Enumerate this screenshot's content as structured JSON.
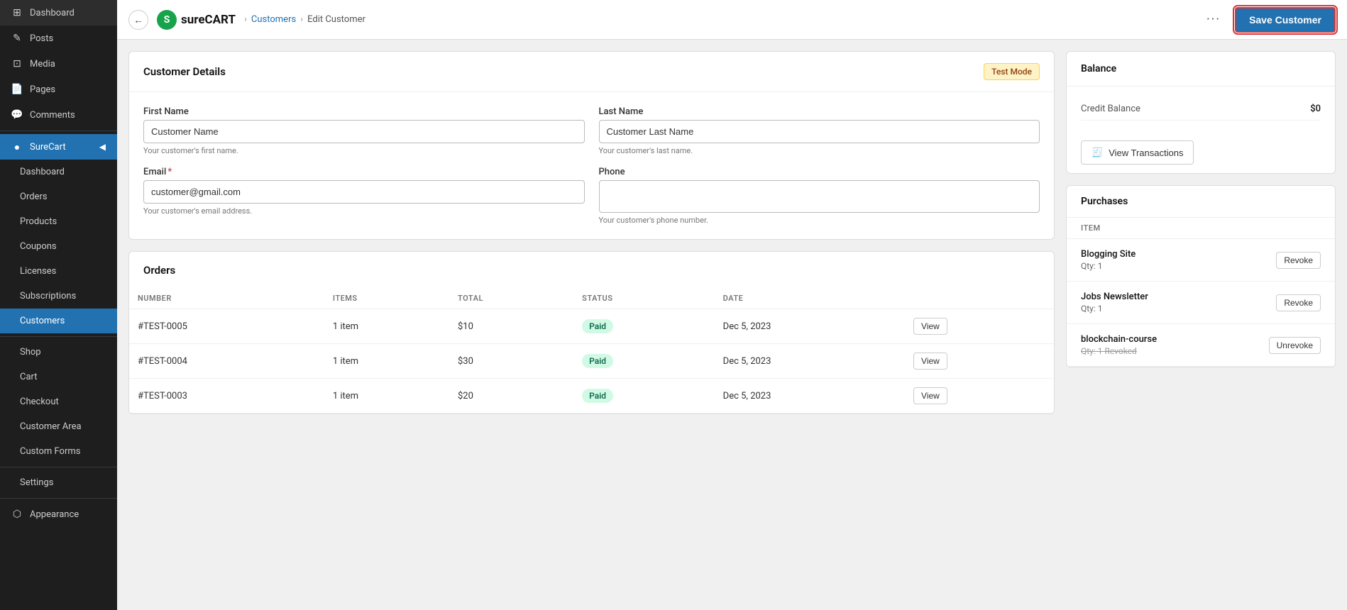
{
  "sidebar": {
    "items": [
      {
        "label": "Dashboard",
        "icon": "⊞",
        "active": false,
        "sub": false
      },
      {
        "label": "Posts",
        "icon": "✎",
        "active": false,
        "sub": false
      },
      {
        "label": "Media",
        "icon": "⊡",
        "active": false,
        "sub": false
      },
      {
        "label": "Pages",
        "icon": "📄",
        "active": false,
        "sub": false
      },
      {
        "label": "Comments",
        "icon": "💬",
        "active": false,
        "sub": false
      },
      {
        "label": "SureCart",
        "icon": "●",
        "active": true,
        "sub": false
      },
      {
        "label": "Dashboard",
        "icon": "",
        "active": false,
        "sub": true
      },
      {
        "label": "Orders",
        "icon": "",
        "active": false,
        "sub": true
      },
      {
        "label": "Products",
        "icon": "",
        "active": false,
        "sub": true
      },
      {
        "label": "Coupons",
        "icon": "",
        "active": false,
        "sub": true
      },
      {
        "label": "Licenses",
        "icon": "",
        "active": false,
        "sub": true
      },
      {
        "label": "Subscriptions",
        "icon": "",
        "active": false,
        "sub": true
      },
      {
        "label": "Customers",
        "icon": "",
        "active": false,
        "sub": true,
        "highlight": true
      },
      {
        "label": "Shop",
        "icon": "",
        "active": false,
        "sub": true
      },
      {
        "label": "Cart",
        "icon": "",
        "active": false,
        "sub": true
      },
      {
        "label": "Checkout",
        "icon": "",
        "active": false,
        "sub": true
      },
      {
        "label": "Customer Area",
        "icon": "",
        "active": false,
        "sub": true
      },
      {
        "label": "Custom Forms",
        "icon": "",
        "active": false,
        "sub": true
      },
      {
        "label": "Settings",
        "icon": "",
        "active": false,
        "sub": true
      },
      {
        "label": "Appearance",
        "icon": "⬡",
        "active": false,
        "sub": false
      }
    ]
  },
  "topbar": {
    "back_label": "←",
    "logo_initial": "S",
    "logo_text_bold": "sure",
    "logo_text_light": "CART",
    "breadcrumb": [
      "Customers",
      "Edit Customer"
    ],
    "dots_label": "···",
    "save_button_label": "Save Customer"
  },
  "customer_details": {
    "card_title": "Customer Details",
    "test_mode_badge": "Test Mode",
    "first_name_label": "First Name",
    "first_name_value": "Customer Name",
    "first_name_hint": "Your customer's first name.",
    "last_name_label": "Last Name",
    "last_name_value": "Customer Last Name",
    "last_name_hint": "Your customer's last name.",
    "email_label": "Email",
    "email_required": "*",
    "email_value": "customer@gmail.com",
    "email_hint": "Your customer's email address.",
    "phone_label": "Phone",
    "phone_value": "",
    "phone_hint": "Your customer's phone number."
  },
  "orders": {
    "card_title": "Orders",
    "columns": [
      "NUMBER",
      "ITEMS",
      "TOTAL",
      "STATUS",
      "DATE",
      ""
    ],
    "rows": [
      {
        "number": "#TEST-0005",
        "items": "1 item",
        "total": "$10",
        "status": "Paid",
        "date": "Dec 5, 2023",
        "action": "View"
      },
      {
        "number": "#TEST-0004",
        "items": "1 item",
        "total": "$30",
        "status": "Paid",
        "date": "Dec 5, 2023",
        "action": "View"
      },
      {
        "number": "#TEST-0003",
        "items": "1 item",
        "total": "$20",
        "status": "Paid",
        "date": "Dec 5, 2023",
        "action": "View"
      }
    ]
  },
  "balance": {
    "card_title": "Balance",
    "credit_balance_label": "Credit Balance",
    "credit_balance_value": "$0",
    "view_transactions_label": "View Transactions",
    "transaction_icon": "🧾"
  },
  "purchases": {
    "card_title": "Purchases",
    "col_header": "ITEM",
    "items": [
      {
        "name": "Blogging Site",
        "qty": "Qty: 1",
        "action": "Revoke",
        "revoked": false
      },
      {
        "name": "Jobs Newsletter",
        "qty": "Qty: 1",
        "action": "Revoke",
        "revoked": false
      },
      {
        "name": "blockchain-course",
        "qty": "Qty: 1  Revoked",
        "action": "Unrevoke",
        "revoked": true
      }
    ]
  }
}
